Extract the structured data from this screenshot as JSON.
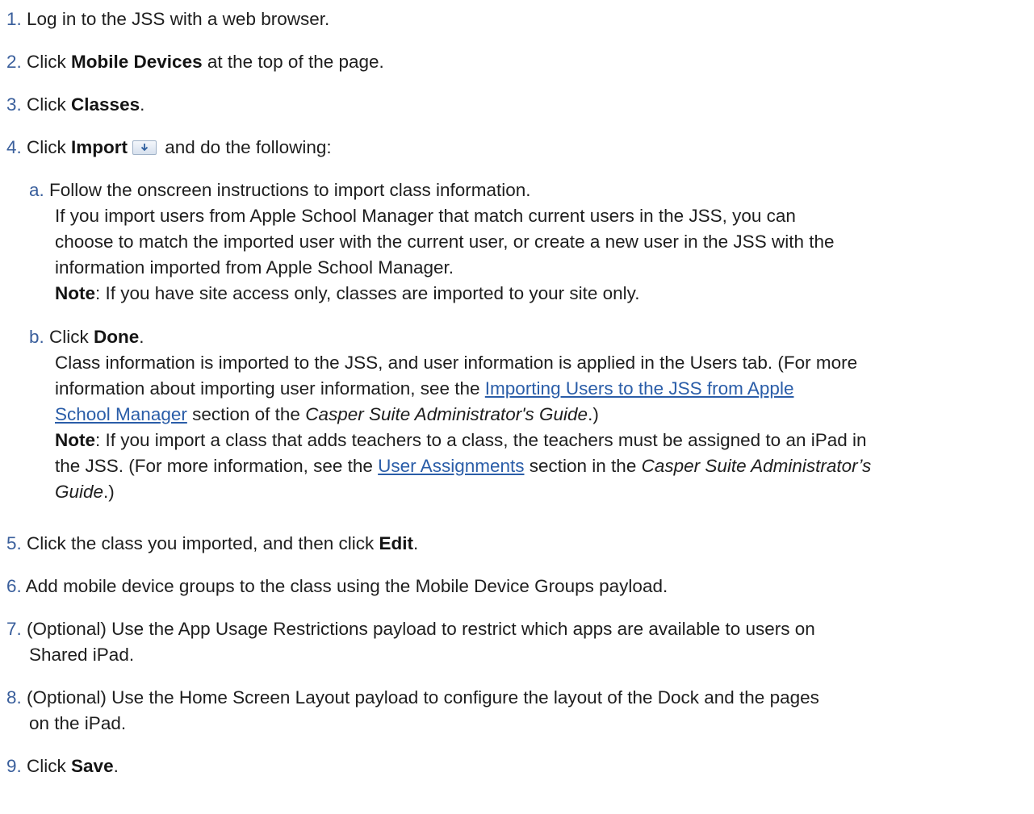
{
  "steps": [
    {
      "num": "1.",
      "pre": "Log in to the JSS with a web browser."
    },
    {
      "num": "2.",
      "pre": "Click ",
      "bold": "Mobile Devices",
      "post": " at the top of the page."
    },
    {
      "num": "3.",
      "pre": "Click ",
      "bold": "Classes",
      "post": "."
    },
    {
      "num": "4.",
      "pre": "Click ",
      "bold": "Import",
      "post": " and do the following:",
      "icon": "download-arrow-icon"
    },
    {
      "num": "5.",
      "pre": "Click the class you imported, and then click ",
      "bold": "Edit",
      "post": "."
    },
    {
      "num": "6.",
      "pre": "Add mobile device groups to the class using the Mobile Device Groups payload."
    },
    {
      "num": "7.",
      "line1": "(Optional) Use the App Usage Restrictions payload to restrict which apps are available to users on",
      "line2": "Shared iPad."
    },
    {
      "num": "8.",
      "line1": "(Optional) Use the Home Screen Layout payload to configure the layout of the Dock and the pages",
      "line2": "on the iPad."
    },
    {
      "num": "9.",
      "pre": "Click ",
      "bold": "Save",
      "post": "."
    }
  ],
  "sub_a": {
    "letter": "a.",
    "line1": "Follow the onscreen instructions to import class information.",
    "line2": "If you import users from Apple School Manager that match current users in the JSS, you can",
    "line3": "choose to match the imported user with the current user, or create a new user in the JSS with the",
    "line4": "information imported from Apple School Manager.",
    "note_label": "Note",
    "note_text": ": If you have site access only, classes are imported to your site only."
  },
  "sub_b": {
    "letter": "b.",
    "pre": "Click ",
    "bold": "Done",
    "post": ".",
    "p1_line1": "Class information is imported to the JSS, and user information is applied in the Users tab. (For more",
    "p1_line2_pre": "information about importing user information, see the ",
    "p1_link_part1": "Importing Users to the JSS from Apple ",
    "p1_link_part2": "School Manager",
    "p1_line3_mid": " section of the ",
    "p1_guide": "Casper Suite Administrator's Guide",
    "p1_end": ".)",
    "note_label": "Note",
    "note_line1": ": If you import a class that adds teachers to a class, the teachers must be assigned to an iPad in",
    "note_line2_pre": "the JSS. (For more information, see the ",
    "note_link": "User Assignments",
    "note_line2_mid": " section in the ",
    "note_guide": "Casper Suite Administrator’s",
    "note_line3_guide": "Guide",
    "note_end": ".)"
  }
}
